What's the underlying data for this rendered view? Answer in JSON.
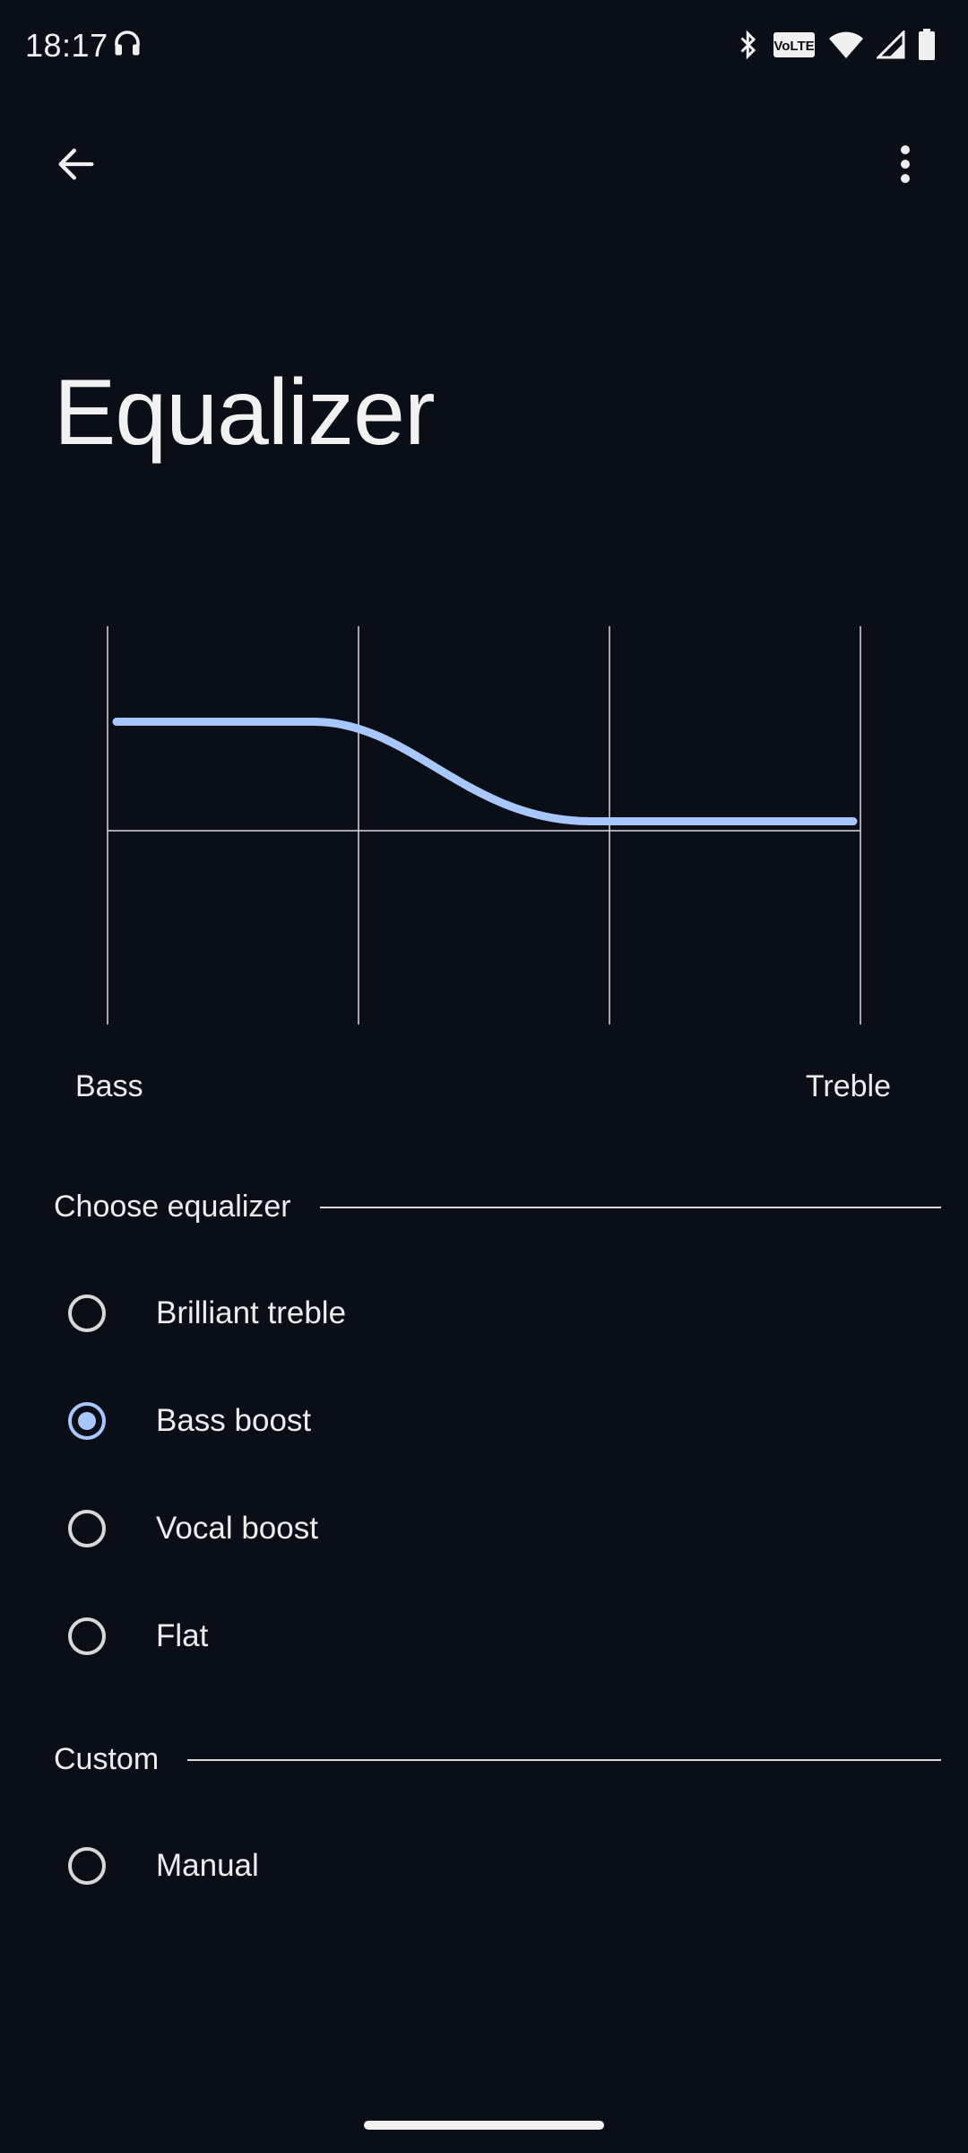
{
  "status_bar": {
    "time": "18:17",
    "icons": [
      "headphones-icon",
      "bluetooth-icon",
      "volte-icon",
      "wifi-icon",
      "cell-signal-icon",
      "battery-icon"
    ],
    "volte_text": "VoLTE"
  },
  "app_bar": {
    "back_icon": "arrow-back-icon",
    "more_icon": "more-vertical-icon"
  },
  "page": {
    "title": "Equalizer"
  },
  "graph": {
    "curve_color": "#a9c7ff",
    "grid_color": "#d9d9d9",
    "curve_start_level": 0.76,
    "curve_end_level": 0.51,
    "bass_label": "Bass",
    "treble_label": "Treble"
  },
  "choose_section": {
    "title": "Choose equalizer",
    "options": [
      {
        "label": "Brilliant treble",
        "selected": false
      },
      {
        "label": "Bass boost",
        "selected": true
      },
      {
        "label": "Vocal boost",
        "selected": false
      },
      {
        "label": "Flat",
        "selected": false
      }
    ]
  },
  "custom_section": {
    "title": "Custom",
    "options": [
      {
        "label": "Manual",
        "selected": false
      }
    ]
  },
  "colors": {
    "background": "#0a0e17",
    "accent": "#a9c7ff",
    "text": "#ececec"
  }
}
